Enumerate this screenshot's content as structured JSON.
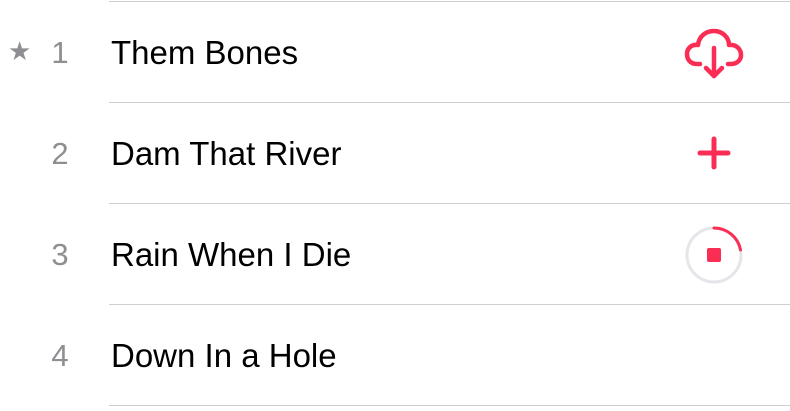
{
  "colors": {
    "accent": "#fa2d55",
    "secondary_text": "#8e8e93",
    "separator": "#cfcfd3",
    "ring_track": "#e5e5ea"
  },
  "tracks": [
    {
      "number": "1",
      "favorite_mark": "★",
      "title": "Them Bones",
      "action_icon": "cloud-download-icon"
    },
    {
      "number": "2",
      "title": "Dam That River",
      "action_icon": "add-icon"
    },
    {
      "number": "3",
      "title": "Rain When I Die",
      "action_icon": "download-progress-stop-icon",
      "download_progress": 0.22
    },
    {
      "number": "4",
      "title": "Down In a Hole",
      "action_icon": ""
    }
  ]
}
